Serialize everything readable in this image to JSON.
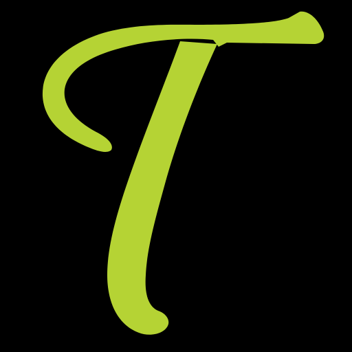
{
  "logo": {
    "letter": "T",
    "fill_color": "#b5d334",
    "background_color": "#000000"
  }
}
